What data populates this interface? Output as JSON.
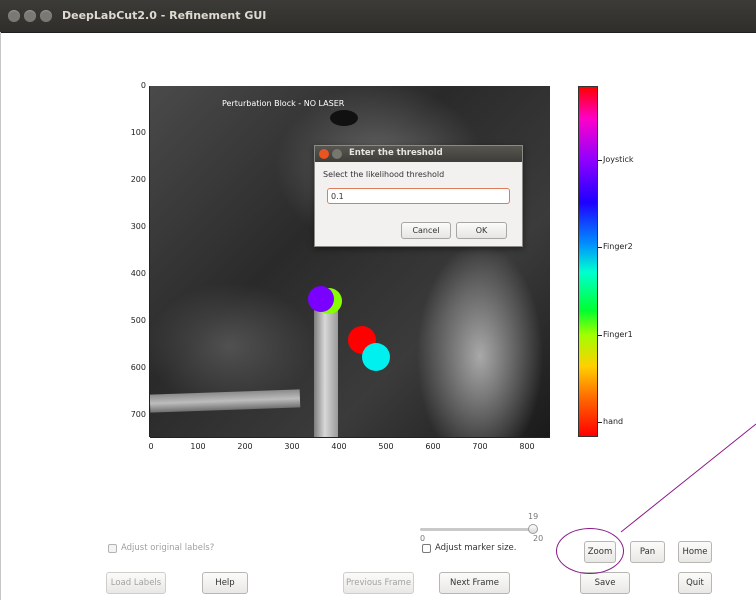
{
  "window": {
    "title": "DeepLabCut2.0 - Refinement GUI"
  },
  "plot": {
    "caption": "Perturbation Block - NO LASER",
    "y_ticks": [
      "0",
      "100",
      "200",
      "300",
      "400",
      "500",
      "600",
      "700"
    ],
    "x_ticks": [
      "0",
      "100",
      "200",
      "300",
      "400",
      "500",
      "600",
      "700",
      "800"
    ]
  },
  "markers": [
    {
      "name": "Joystick",
      "color": "#7a00ff"
    },
    {
      "name": "Finger1",
      "color": "#88ff00"
    },
    {
      "name": "hand",
      "color": "#ff0000"
    },
    {
      "name": "Finger2",
      "color": "#00f0f0"
    }
  ],
  "colorbar": {
    "labels": [
      "Joystick",
      "Finger2",
      "Finger1",
      "hand"
    ]
  },
  "dialog": {
    "title": "Enter the threshold",
    "prompt": "Select the likelihood threshold",
    "input_value": "0.1",
    "cancel_label": "Cancel",
    "ok_label": "OK"
  },
  "slider": {
    "max_label": "19",
    "min_label": "0",
    "value_label": "20"
  },
  "controls": {
    "adjust_original_labels": "Adjust original labels?",
    "adjust_marker_size": "Adjust marker size.",
    "zoom": "Zoom",
    "pan": "Pan",
    "home": "Home",
    "load_labels": "Load Labels",
    "help": "Help",
    "previous_frame": "Previous Frame",
    "next_frame": "Next Frame",
    "save": "Save",
    "quit": "Quit"
  },
  "annotation_color": "#8a1b8a"
}
